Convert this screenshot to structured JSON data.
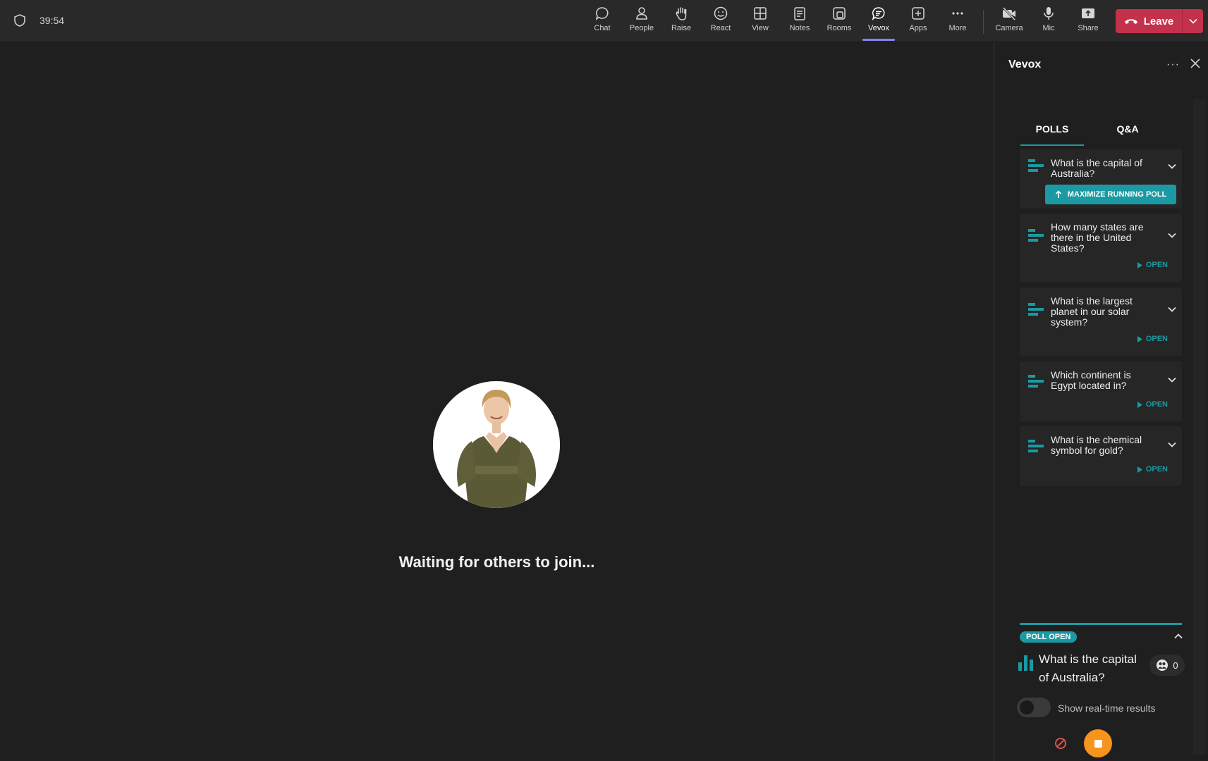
{
  "meeting": {
    "timer": "39:54"
  },
  "toolbar": {
    "items": [
      {
        "label": "Chat",
        "icon": "chat-icon"
      },
      {
        "label": "People",
        "icon": "people-icon"
      },
      {
        "label": "Raise",
        "icon": "raise-hand-icon"
      },
      {
        "label": "React",
        "icon": "react-icon"
      },
      {
        "label": "View",
        "icon": "view-icon"
      },
      {
        "label": "Notes",
        "icon": "notes-icon"
      },
      {
        "label": "Rooms",
        "icon": "rooms-icon"
      },
      {
        "label": "Vevox",
        "icon": "vevox-icon"
      },
      {
        "label": "Apps",
        "icon": "apps-icon"
      },
      {
        "label": "More",
        "icon": "more-icon"
      },
      {
        "label": "Camera",
        "icon": "camera-off-icon"
      },
      {
        "label": "Mic",
        "icon": "mic-icon"
      },
      {
        "label": "Share",
        "icon": "share-icon"
      }
    ],
    "active": "Vevox",
    "leave_label": "Leave"
  },
  "stage": {
    "waiting_text": "Waiting for others to join..."
  },
  "panel": {
    "title": "Vevox",
    "tabs": [
      {
        "label": "POLLS",
        "active": true
      },
      {
        "label": "Q&A",
        "active": false
      }
    ],
    "polls": [
      {
        "question": "What is the capital of Australia?",
        "action": "MAXIMIZE RUNNING POLL",
        "running": true
      },
      {
        "question": "How many states are there in the United States?",
        "action": "OPEN",
        "running": false
      },
      {
        "question": "What is the largest planet in our solar system?",
        "action": "OPEN",
        "running": false
      },
      {
        "question": "Which continent is Egypt located in?",
        "action": "OPEN",
        "running": false
      },
      {
        "question": "What is the chemical symbol for gold?",
        "action": "OPEN",
        "running": false
      }
    ],
    "live": {
      "badge": "POLL OPEN",
      "question": "What is the capital of Australia?",
      "responses": "0",
      "toggle_label": "Show real-time results",
      "toggle_on": false
    }
  },
  "colors": {
    "accent": "#1b9aa3",
    "leave": "#c4314b",
    "stop": "#f7941d",
    "active_tab_indicator": "#7f85f5"
  }
}
